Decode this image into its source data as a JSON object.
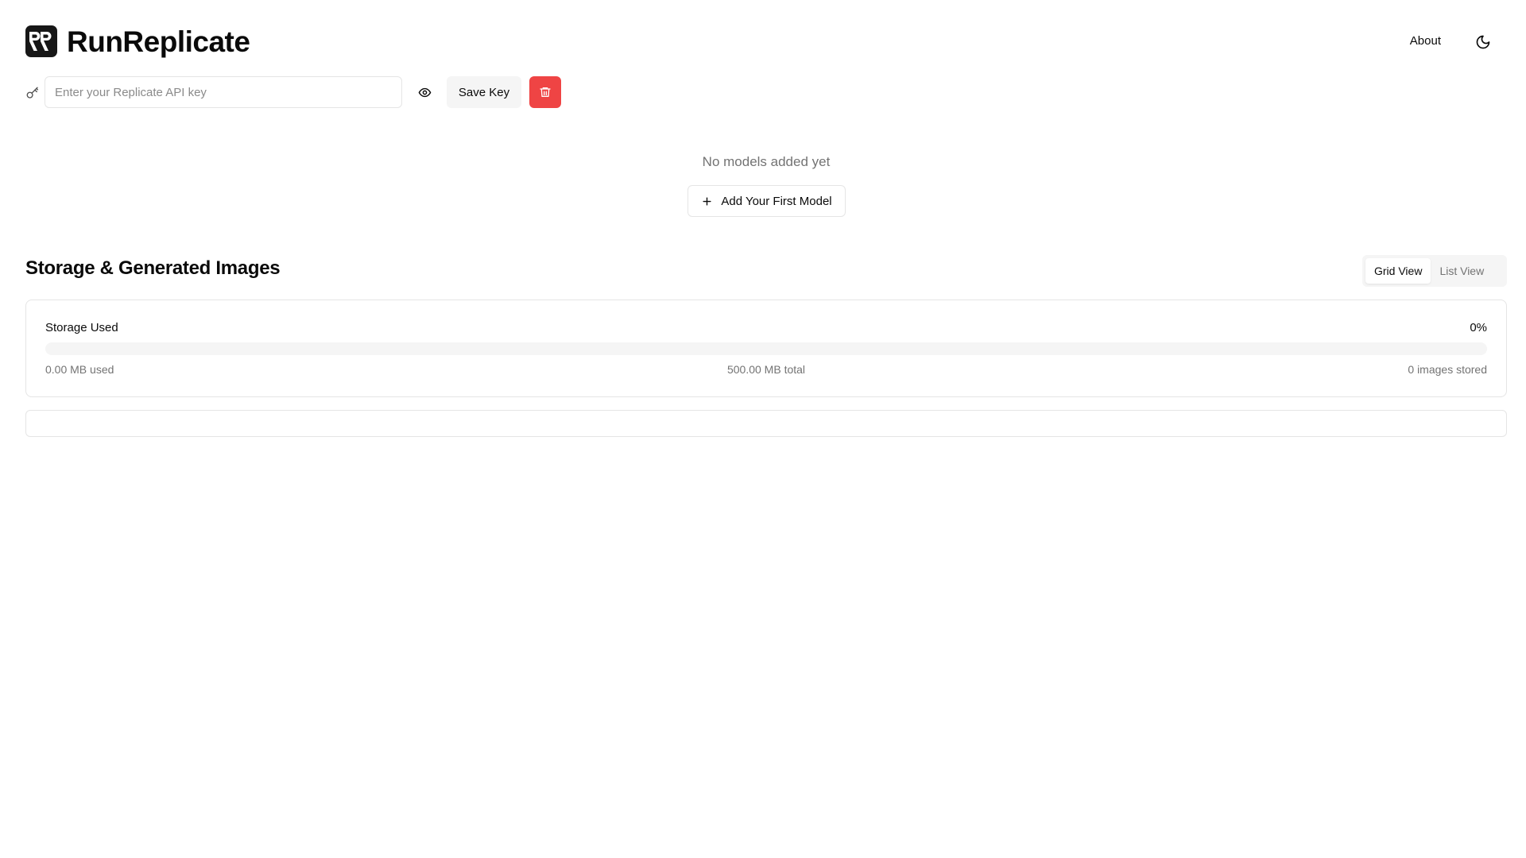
{
  "header": {
    "app_title": "RunReplicate",
    "logo_icon": "rr-logo-icon",
    "about_label": "About",
    "theme_toggle_icon": "moon-icon"
  },
  "api_key": {
    "key_icon": "key-icon",
    "value": "",
    "placeholder": "Enter your Replicate API key",
    "toggle_visibility_icon": "eye-icon",
    "save_label": "Save Key",
    "delete_icon": "trash-icon",
    "delete_color": "#ef4444"
  },
  "models": {
    "empty_text": "No models added yet",
    "add_icon": "plus-icon",
    "add_label": "Add Your First Model"
  },
  "storage": {
    "section_title": "Storage & Generated Images",
    "views": [
      {
        "label": "Grid View",
        "active": true
      },
      {
        "label": "List View",
        "active": false
      }
    ],
    "used_label": "Storage Used",
    "percent_text": "0%",
    "percent_value": 0,
    "used_text": "0.00 MB used",
    "total_text": "500.00 MB total",
    "count_text": "0 images stored"
  }
}
